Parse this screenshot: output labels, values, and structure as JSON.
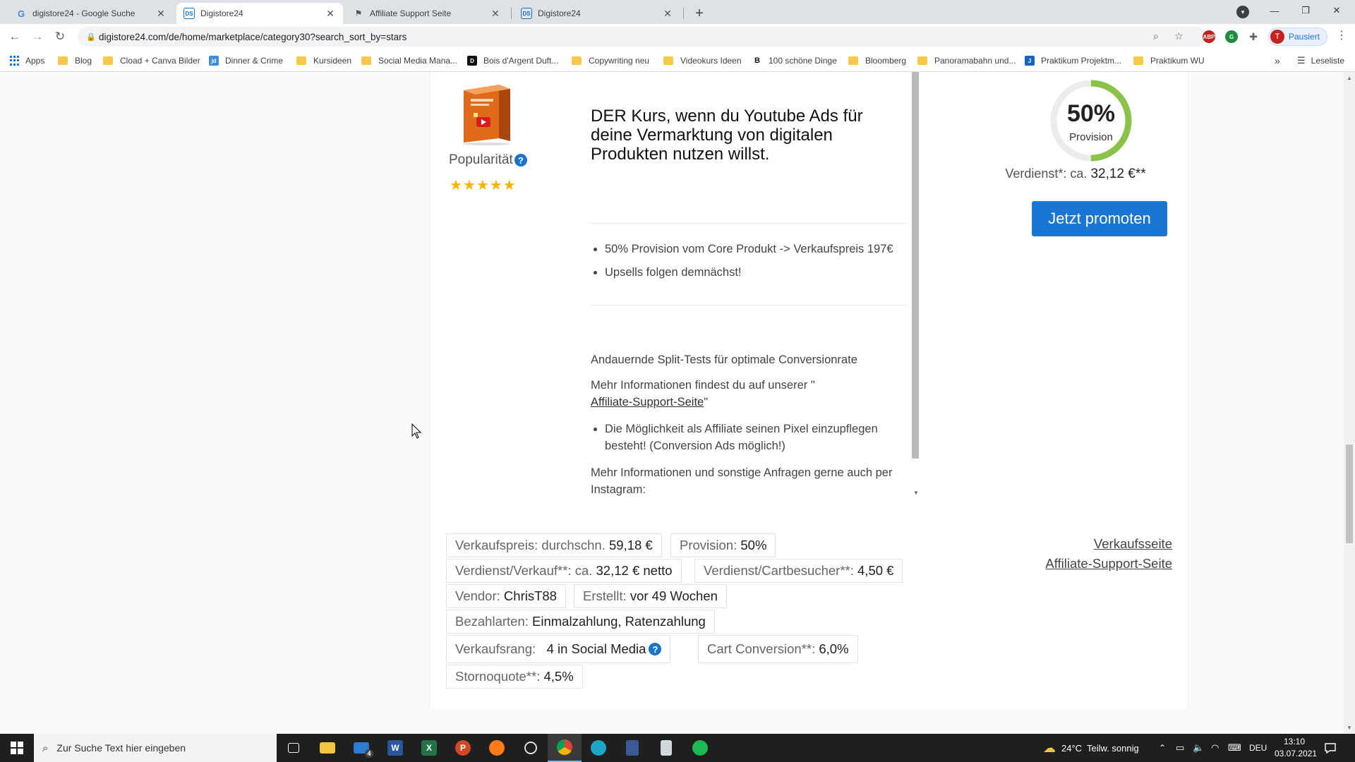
{
  "browser": {
    "tabs": [
      {
        "title": "digistore24 - Google Suche",
        "icon": "google-icon",
        "active": false
      },
      {
        "title": "Digistore24",
        "icon": "digistore-icon",
        "active": true
      },
      {
        "title": "Affiliate Support Seite",
        "icon": "flag-icon",
        "active": false
      },
      {
        "title": "Digistore24",
        "icon": "digistore-icon",
        "active": false
      }
    ],
    "url": "digistore24.com/de/home/marketplace/category30?search_sort_by=stars",
    "profile_label": "Pausiert",
    "profile_initial": "T",
    "bookmarks": [
      {
        "label": "Apps"
      },
      {
        "label": "Blog"
      },
      {
        "label": "Cload + Canva Bilder"
      },
      {
        "label": "Dinner & Crime"
      },
      {
        "label": "Kursideen"
      },
      {
        "label": "Social Media Mana..."
      },
      {
        "label": "Bois d'Argent Duft..."
      },
      {
        "label": "Copywriting neu"
      },
      {
        "label": "Videokurs Ideen"
      },
      {
        "label": "100 schöne Dinge"
      },
      {
        "label": "Bloomberg"
      },
      {
        "label": "Panoramabahn und..."
      },
      {
        "label": "Praktikum Projektm..."
      },
      {
        "label": "Praktikum WU"
      }
    ],
    "reading_list": "Leseliste",
    "more_bookmarks": "»"
  },
  "product": {
    "popularity_label": "Popularität",
    "help_mark": "?",
    "stars": [
      "★",
      "★",
      "★",
      "★",
      "★"
    ],
    "headline": "DER Kurs, wenn du Youtube Ads für deine Vermarktung von digitalen Produkten nutzen willst.",
    "bullets": [
      "50% Provision vom Core Produkt -> Verkaufspreis 197€",
      "Upsells folgen demnächst!"
    ],
    "split_tests": "Andauernde Split-Tests für optimale Conversionrate",
    "more_info_prefix": "Mehr Informationen findest du auf unserer \"",
    "more_info_link": "Affiliate-Support-Seite",
    "more_info_suffix": "\"",
    "pixel_bullet": "Die Möglichkeit als Affiliate seinen Pixel einzupflegen besteht! (Conversion Ads möglich!)",
    "instagram_note": "Mehr Informationen und sonstige Anfragen gerne auch per Instagram:",
    "commission_percent": "50%",
    "commission_fraction": 0.5,
    "commission_label": "Provision",
    "earning_prefix": "Verdienst*: ca.",
    "earning_value": "32,12 €**",
    "promote_button": "Jetzt promoten",
    "accent_color": "#1976d2",
    "ring_color": "#8bc34a"
  },
  "stats": {
    "sale_price_label": "Verkaufspreis: durchschn.",
    "sale_price_value": "59,18 €",
    "provision_label": "Provision:",
    "provision_value": "50%",
    "earning_per_sale_label": "Verdienst/Verkauf**: ca.",
    "earning_per_sale_value": "32,12 € netto",
    "earning_per_cart_label": "Verdienst/Cartbesucher**:",
    "earning_per_cart_value": "4,50 €",
    "vendor_label": "Vendor:",
    "vendor_value": "ChrisT88",
    "created_label": "Erstellt:",
    "created_value": "vor 49 Wochen",
    "payment_label": "Bezahlarten:",
    "payment_value": "Einmalzahlung, Ratenzahlung",
    "rank_label": "Verkaufsrang:",
    "rank_value": "4 in Social Media",
    "cart_conversion_label": "Cart Conversion**:",
    "cart_conversion_value": "6,0%",
    "cancel_label": "Stornoquote**:",
    "cancel_value": "4,5%",
    "sales_page_link": "Verkaufsseite",
    "support_page_link": "Affiliate-Support-Seite"
  },
  "taskbar": {
    "search_placeholder": "Zur Suche Text hier eingeben",
    "mail_badge": "4",
    "weather": "24°C  Teilw. sonnig",
    "language": "DEU",
    "time": "13:10",
    "date": "03.07.2021"
  }
}
